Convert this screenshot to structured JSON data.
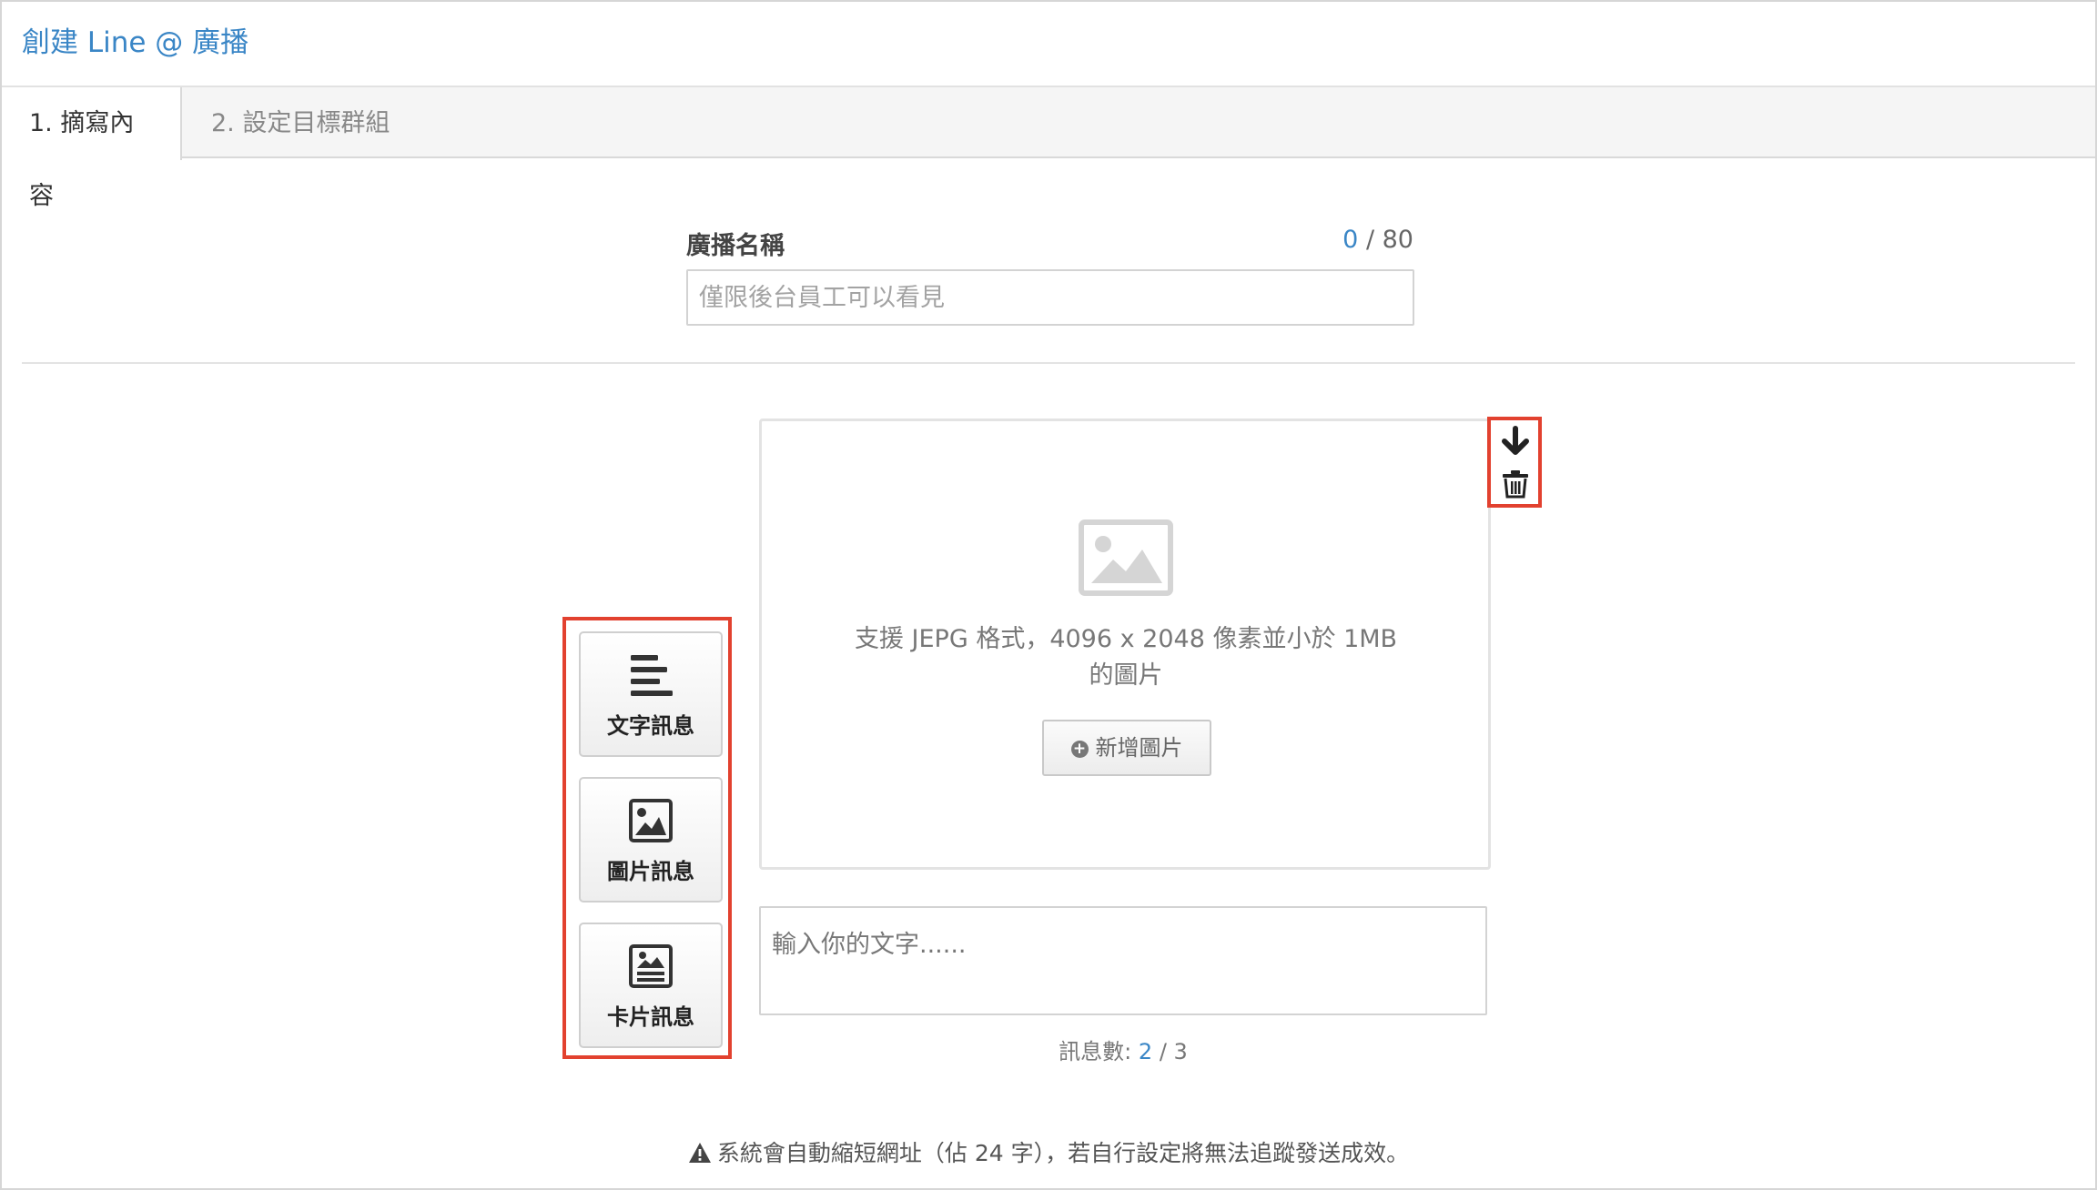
{
  "header": {
    "title": "創建 Line @ 廣播"
  },
  "tabs": [
    {
      "label": "1. 摘寫內容",
      "active": true
    },
    {
      "label": "2. 設定目標群組",
      "active": false
    }
  ],
  "broadcast_name": {
    "label": "廣播名稱",
    "count": "0",
    "max": "/ 80",
    "placeholder": "僅限後台員工可以看見",
    "value": ""
  },
  "message_types": [
    {
      "label": "文字訊息",
      "icon": "text-lines-icon"
    },
    {
      "label": "圖片訊息",
      "icon": "image-icon"
    },
    {
      "label": "卡片訊息",
      "icon": "card-icon"
    }
  ],
  "image_card": {
    "hint_line1": "支援 JEPG 格式，4096 x 2048 像素並小於 1MB",
    "hint_line2": "的圖片",
    "add_button": "新增圖片",
    "actions": [
      "arrow-down-icon",
      "trash-icon"
    ]
  },
  "text_message": {
    "placeholder": "輸入你的文字......"
  },
  "message_count": {
    "label": "訊息數:",
    "current": "2",
    "max": "/ 3"
  },
  "notice": {
    "text": "系統會自動縮短網址（佔 24 字），若自行設定將無法追蹤發送成效。"
  },
  "colors": {
    "accent": "#3a86c6",
    "highlight": "#e2412f",
    "text": "#333333",
    "muted": "#777777"
  }
}
